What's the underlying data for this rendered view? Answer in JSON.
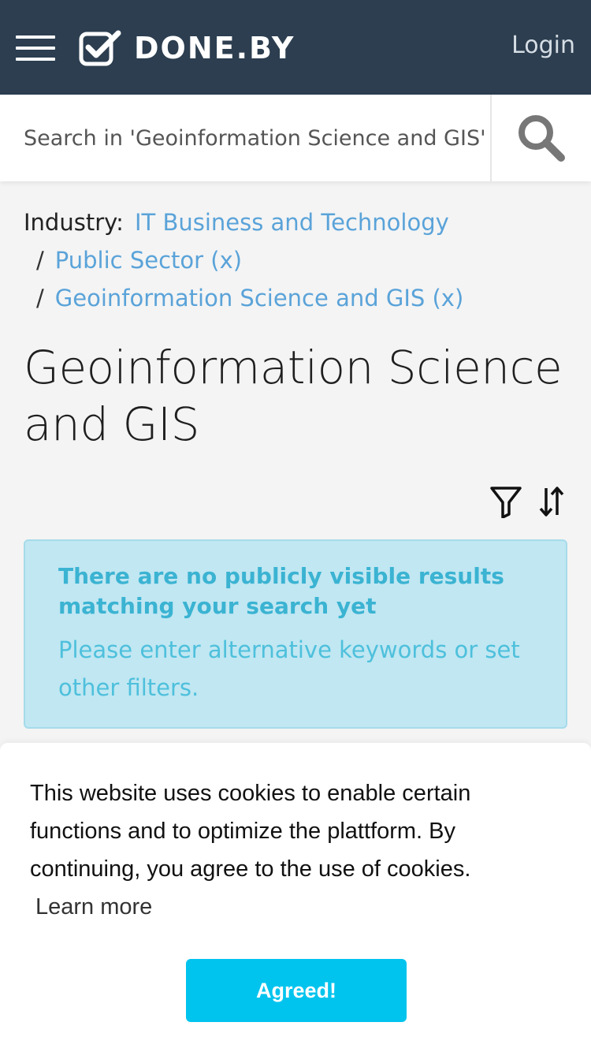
{
  "header": {
    "brand": "DONE.BY",
    "login_label": "Login",
    "menu_icon": "hamburger-menu-icon",
    "logo_icon": "checkbox-check-icon",
    "background_color": "#2c3e50"
  },
  "search": {
    "placeholder": "Search in 'Geoinformation Science and GIS'",
    "icon": "search-icon"
  },
  "breadcrumb": {
    "label": "Industry:",
    "separator": "/",
    "items": [
      {
        "label": "IT Business and Technology"
      },
      {
        "label": "Public Sector (x)"
      },
      {
        "label": "Geoinformation Science and GIS (x)"
      }
    ]
  },
  "page": {
    "title": "Geoinformation Science and GIS"
  },
  "tools": {
    "filter_icon": "filter-icon",
    "sort_icon": "sort-icon"
  },
  "alert": {
    "title": "There are no publicly visible results matching your search yet",
    "body": "Please enter alternative keywords or set other filters.",
    "color": "#c0e7f2"
  },
  "cookie_banner": {
    "text": "This website uses cookies to enable certain functions and to optimize the plattform. By continuing, you agree to the use of cookies.",
    "learn_more": "Learn more",
    "agree_label": "Agreed!",
    "button_color": "#00c4ee"
  }
}
